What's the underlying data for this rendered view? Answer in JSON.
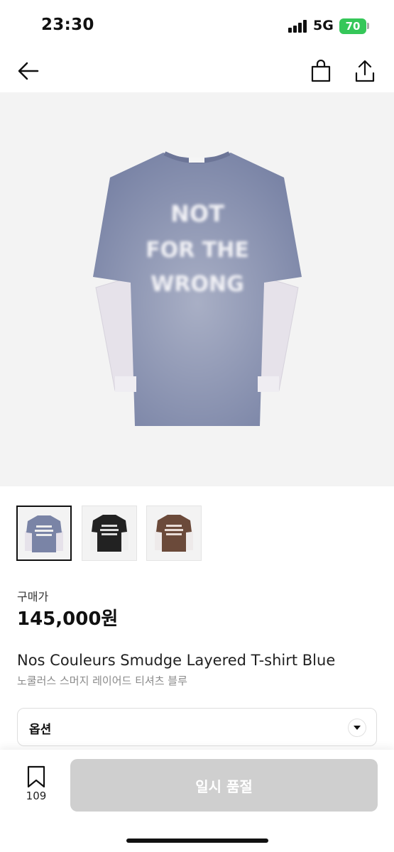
{
  "status_bar": {
    "time": "23:30",
    "network": "5G",
    "battery": "70"
  },
  "nav": {
    "back_icon": "arrow-left-icon",
    "bag_icon": "shopping-bag-icon",
    "share_icon": "share-icon"
  },
  "product": {
    "image_print_text": [
      "NOT",
      "FOR THE",
      "WRONG"
    ],
    "colors": {
      "blue": "#7a84a6",
      "black": "#222222",
      "brown": "#6b4a3a",
      "sleeve": "#e6e2ea"
    },
    "thumbnails": [
      {
        "color": "blue",
        "selected": true
      },
      {
        "color": "black",
        "selected": false
      },
      {
        "color": "brown",
        "selected": false
      }
    ],
    "price_label": "구매가",
    "price": "145,000원",
    "name_en": "Nos Couleurs Smudge Layered T-shirt Blue",
    "name_ko": "노쿨러스 스머지 레이어드 티셔츠 블루"
  },
  "option": {
    "label": "옵션",
    "icon": "chevron-down-icon"
  },
  "bottom": {
    "wish_count": "109",
    "wish_icon": "bookmark-icon",
    "button_label": "일시 품절"
  }
}
